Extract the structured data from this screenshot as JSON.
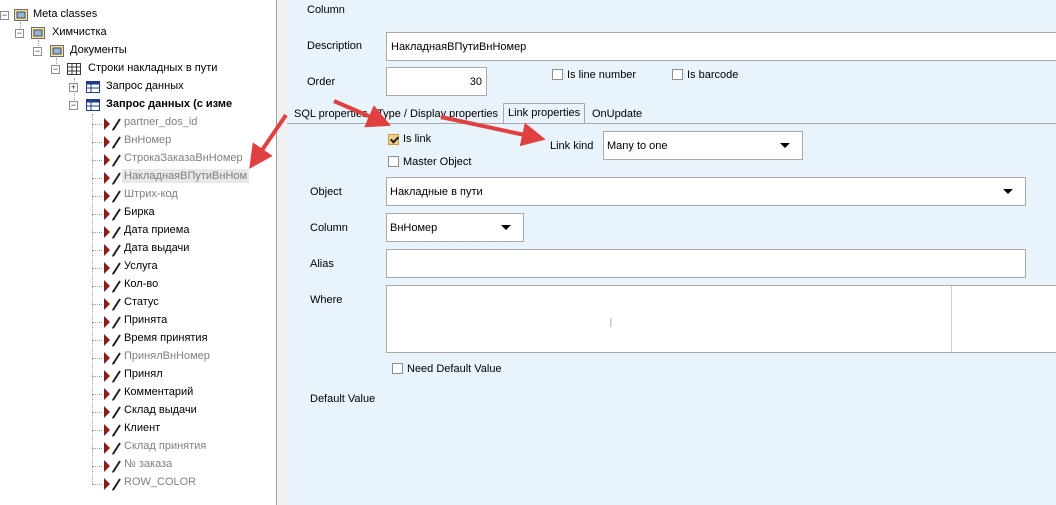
{
  "tree": {
    "root": "Meta classes",
    "level1": "Химчистка",
    "level2": "Документы",
    "level3": "Строки накладных в пути",
    "query1": "Запрос данных",
    "query2": "Запрос данных (с изме",
    "fields": [
      {
        "label": "partner_dos_id",
        "grey": true
      },
      {
        "label": "ВнНомер",
        "grey": true
      },
      {
        "label": "СтрокаЗаказаВнНомер",
        "grey": true
      },
      {
        "label": "НакладнаяВПутиВнНом",
        "grey": true,
        "selected": true
      },
      {
        "label": "Штрих-код",
        "grey": true
      },
      {
        "label": "Бирка",
        "grey": false
      },
      {
        "label": "Дата приема",
        "grey": false
      },
      {
        "label": "Дата выдачи",
        "grey": false
      },
      {
        "label": "Услуга",
        "grey": false
      },
      {
        "label": "Кол-во",
        "grey": false
      },
      {
        "label": "Статус",
        "grey": false
      },
      {
        "label": "Принята",
        "grey": false
      },
      {
        "label": "Время принятия",
        "grey": false
      },
      {
        "label": "ПринялВнНомер",
        "grey": true
      },
      {
        "label": "Принял",
        "grey": false
      },
      {
        "label": "Комментарий",
        "grey": false
      },
      {
        "label": "Склад выдачи",
        "grey": false
      },
      {
        "label": "Клиент",
        "grey": false
      },
      {
        "label": "Склад принятия",
        "grey": true
      },
      {
        "label": "№ заказа",
        "grey": true
      },
      {
        "label": "ROW_COLOR",
        "grey": true
      }
    ]
  },
  "form": {
    "column_label": "Column",
    "description_label": "Description",
    "description_value": "НакладнаяВПутиВнНомер",
    "order_label": "Order",
    "order_value": "30",
    "is_line_number_label": "Is line number",
    "is_barcode_label": "Is barcode"
  },
  "tabs": [
    {
      "label": "SQL properties",
      "active": false
    },
    {
      "label": "Type / Display properties",
      "active": false
    },
    {
      "label": "Link properties",
      "active": true
    },
    {
      "label": "OnUpdate",
      "active": false
    }
  ],
  "link": {
    "is_link_label": "Is link",
    "is_link_checked": true,
    "master_object_label": "Master Object",
    "link_kind_label": "Link kind",
    "link_kind_value": "Many to one",
    "object_label": "Object",
    "object_value": "Накладные в пути",
    "column_label": "Column",
    "column_value": "ВнНомер",
    "alias_label": "Alias",
    "alias_value": "",
    "where_label": "Where",
    "need_default_label": "Need Default Value",
    "default_value_label": "Default Value"
  },
  "colors": {
    "panel_bg": "#e8f3fb",
    "arrow": "#e04040",
    "check_fill": "#f3ce8a"
  }
}
